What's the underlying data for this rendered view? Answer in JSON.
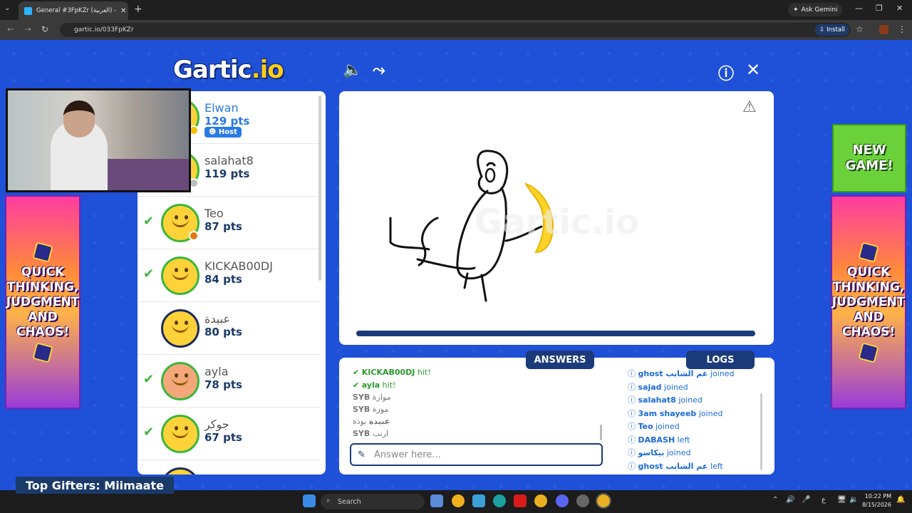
{
  "browser": {
    "tab_title": "General #3FpKZr (العربية) - Gart",
    "url": "gartic.io/033FpKZr",
    "ask_gemini": "Ask Gemini",
    "install_label": "Install"
  },
  "game": {
    "logo_text": "Gartic.io",
    "players": [
      {
        "name": "Elwan",
        "points": "129 pts",
        "badge": "Host",
        "guessed": false
      },
      {
        "name": "salahat8",
        "points": "119 pts",
        "guessed": false
      },
      {
        "name": "Teo",
        "points": "87 pts",
        "guessed": true
      },
      {
        "name": "KICKAB00DJ",
        "points": "84 pts",
        "guessed": true
      },
      {
        "name": "عبيدة",
        "points": "80 pts",
        "guessed": false
      },
      {
        "name": "ayla",
        "points": "78 pts",
        "guessed": true
      },
      {
        "name": "جوكر",
        "points": "67 pts",
        "guessed": true
      }
    ],
    "answers_tab": "ANSWERS",
    "logs_tab": "LOGS",
    "answers": [
      {
        "user": "KICKAB00DJ",
        "text": "hit!",
        "hit": true
      },
      {
        "user": "ayla",
        "text": "hit!",
        "hit": true
      },
      {
        "user": "SYB",
        "text": "موازة",
        "hit": false
      },
      {
        "user": "SYB",
        "text": "موزة",
        "hit": false
      },
      {
        "user": "عبيدة",
        "text": "بوذة",
        "hit": false
      },
      {
        "user": "SYB",
        "text": "ارنب",
        "hit": false
      }
    ],
    "logs": [
      {
        "user": "ghost عم الشايب",
        "action": "joined"
      },
      {
        "user": "sajad",
        "action": "joined"
      },
      {
        "user": "salahat8",
        "action": "joined"
      },
      {
        "user": "3am shayeeb",
        "action": "joined"
      },
      {
        "user": "Teo",
        "action": "joined"
      },
      {
        "user": "DABASH",
        "action": "left"
      },
      {
        "user": "بيكاسو",
        "action": "joined"
      },
      {
        "user": "ghost عم الشايب",
        "action": "left"
      }
    ],
    "answer_placeholder": "Answer here...",
    "banner_left": "QUICK THINKING, JUDGMENT AND CHAOS!",
    "banner_right": "QUICK THINKING, JUDGMENT AND CHAOS!",
    "new_game": "NEW GAME!"
  },
  "overlay": {
    "top_gifters": "Top Gifters: Miimaate"
  },
  "taskbar": {
    "search_label": "Search",
    "time": "10:22 PM",
    "date": "8/15/2026",
    "lang": "ع"
  }
}
